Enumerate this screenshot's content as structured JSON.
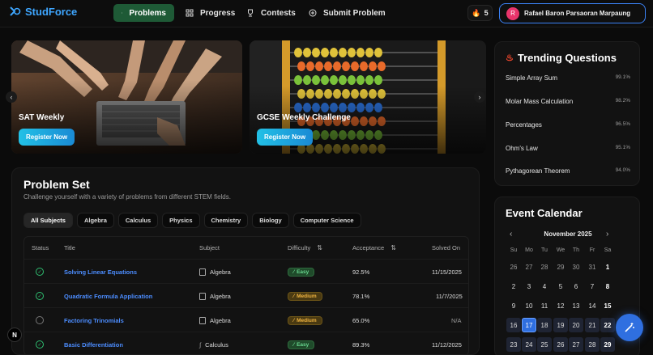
{
  "brand": {
    "name": "StudForce",
    "accent": "#3ea6ff"
  },
  "nav": {
    "items": [
      {
        "label": "Problems",
        "icon": "list-icon",
        "active": true
      },
      {
        "label": "Progress",
        "icon": "grid-icon",
        "active": false
      },
      {
        "label": "Contests",
        "icon": "trophy-icon",
        "active": false
      },
      {
        "label": "Submit Problem",
        "icon": "plus-circle-icon",
        "active": false
      }
    ],
    "streak": "5",
    "user": {
      "initial": "R",
      "name": "Rafael Baron Parsaoran Marpaung"
    }
  },
  "carousel": {
    "slides": [
      {
        "title": "SAT Weekly",
        "button": "Register Now",
        "image": "hands-on-laptop-photo"
      },
      {
        "title": "GCSE Weekly Challenge",
        "button": "Register Now",
        "image": "abacus-photo"
      }
    ]
  },
  "problem_set": {
    "title": "Problem Set",
    "subtitle": "Challenge yourself with a variety of problems from different STEM fields.",
    "filters": [
      "All Subjects",
      "Algebra",
      "Calculus",
      "Physics",
      "Chemistry",
      "Biology",
      "Computer Science"
    ],
    "active_filter": "All Subjects",
    "columns": {
      "status": "Status",
      "title": "Title",
      "subject": "Subject",
      "difficulty": "Difficulty",
      "acceptance": "Acceptance",
      "solved_on": "Solved On"
    },
    "rows": [
      {
        "solved": true,
        "title": "Solving Linear Equations",
        "subject": "Algebra",
        "difficulty": "Easy",
        "acceptance": "92.5%",
        "solved_on": "11/15/2025"
      },
      {
        "solved": true,
        "title": "Quadratic Formula Application",
        "subject": "Algebra",
        "difficulty": "Medium",
        "acceptance": "78.1%",
        "solved_on": "11/7/2025"
      },
      {
        "solved": false,
        "title": "Factoring Trinomials",
        "subject": "Algebra",
        "difficulty": "Medium",
        "acceptance": "65.0%",
        "solved_on": "N/A"
      },
      {
        "solved": true,
        "title": "Basic Differentiation",
        "subject": "Calculus",
        "difficulty": "Easy",
        "acceptance": "89.3%",
        "solved_on": "11/12/2025"
      }
    ]
  },
  "trending": {
    "title": "Trending Questions",
    "items": [
      {
        "name": "Simple Array Sum",
        "pct": "99.1%"
      },
      {
        "name": "Molar Mass Calculation",
        "pct": "98.2%"
      },
      {
        "name": "Percentages",
        "pct": "96.5%"
      },
      {
        "name": "Ohm's Law",
        "pct": "95.1%"
      },
      {
        "name": "Pythagorean Theorem",
        "pct": "94.0%"
      }
    ]
  },
  "calendar": {
    "title": "Event Calendar",
    "month": "November 2025",
    "weekdays": [
      "Su",
      "Mo",
      "Tu",
      "We",
      "Th",
      "Fr",
      "Sa"
    ],
    "weeks": [
      [
        "26",
        "27",
        "28",
        "29",
        "30",
        "31",
        "1"
      ],
      [
        "2",
        "3",
        "4",
        "5",
        "6",
        "7",
        "8"
      ],
      [
        "9",
        "10",
        "11",
        "12",
        "13",
        "14",
        "15"
      ],
      [
        "16",
        "17",
        "18",
        "19",
        "20",
        "21",
        "22"
      ],
      [
        "23",
        "24",
        "25",
        "26",
        "27",
        "28",
        "29"
      ]
    ],
    "today": "17"
  },
  "corner_badge": "N"
}
